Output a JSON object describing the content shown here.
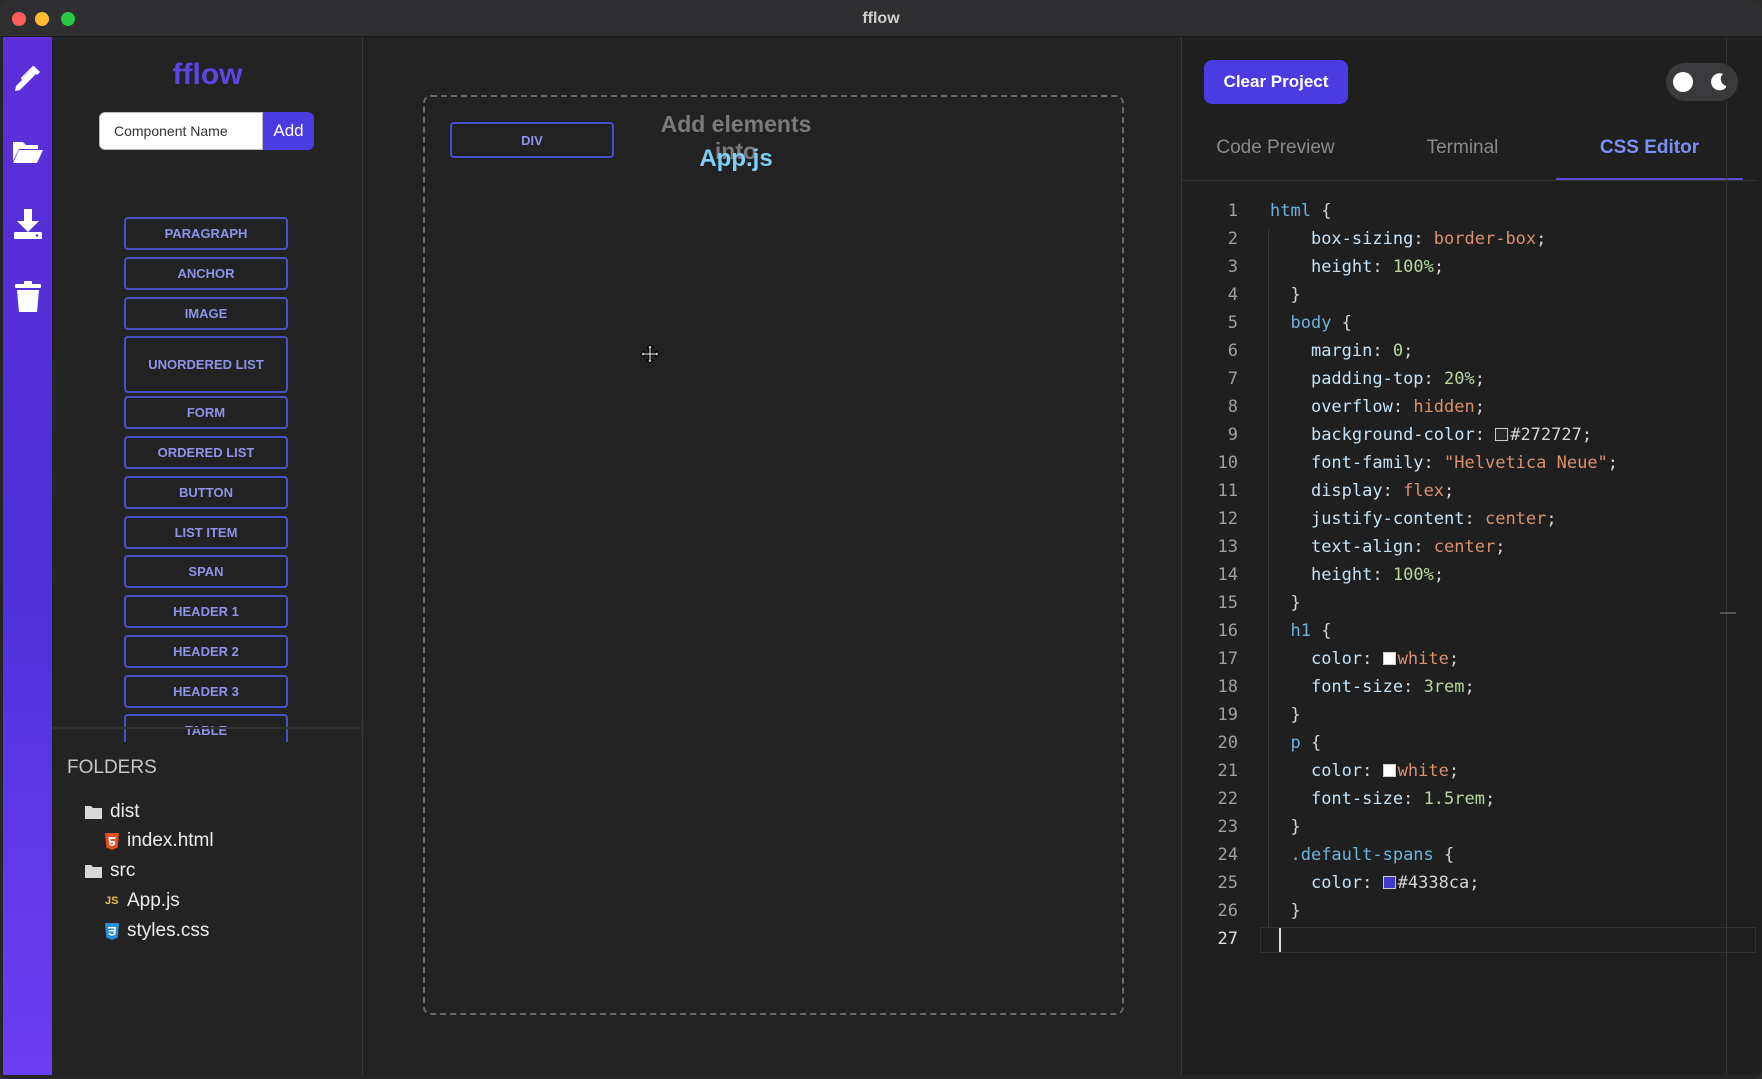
{
  "window": {
    "title": "fflow"
  },
  "rail": {
    "icons": [
      "design-tools-icon",
      "folder-open-icon",
      "download-icon",
      "trash-icon"
    ]
  },
  "sidebar": {
    "brand": "fflow",
    "component_input": {
      "placeholder": "Component Name"
    },
    "add_label": "Add",
    "elements": [
      "PARAGRAPH",
      "ANCHOR",
      "IMAGE",
      "UNORDERED LIST",
      "FORM",
      "ORDERED LIST",
      "BUTTON",
      "LIST ITEM",
      "SPAN",
      "HEADER 1",
      "HEADER 2",
      "HEADER 3",
      "TABLE"
    ]
  },
  "folders": {
    "title": "FOLDERS",
    "tree": [
      {
        "type": "folder",
        "name": "dist"
      },
      {
        "type": "html-file",
        "name": "index.html"
      },
      {
        "type": "folder",
        "name": "src"
      },
      {
        "type": "js-file",
        "name": "App.js"
      },
      {
        "type": "css-file",
        "name": "styles.css"
      }
    ]
  },
  "canvas": {
    "div_label": "DIV",
    "hint": "Add elements into",
    "target_file": "App.js"
  },
  "right": {
    "clear_label": "Clear Project",
    "theme": "dark",
    "tabs": [
      "Code Preview",
      "Terminal",
      "CSS Editor"
    ],
    "active_tab": "CSS Editor"
  },
  "colors": {
    "accent": "#4c3be0",
    "rail": "#5c2fd8",
    "link": "#7ecef6"
  },
  "css_code": [
    "html {",
    "  box-sizing: border-box;",
    "  height: 100%;",
    "}",
    "body {",
    "  margin: 0;",
    "  padding-top: 20%;",
    "  overflow: hidden;",
    "  background-color: #272727;",
    "  font-family: \"Helvetica Neue\";",
    "  display: flex;",
    "  justify-content: center;",
    "  text-align: center;",
    "  height: 100%;",
    "}",
    "h1 {",
    "  color: white;",
    "  font-size: 3rem;",
    "}",
    "p {",
    "  color: white;",
    "  font-size: 1.5rem;",
    "}",
    ".default-spans {",
    "  color: #4338ca;",
    "}",
    ""
  ]
}
